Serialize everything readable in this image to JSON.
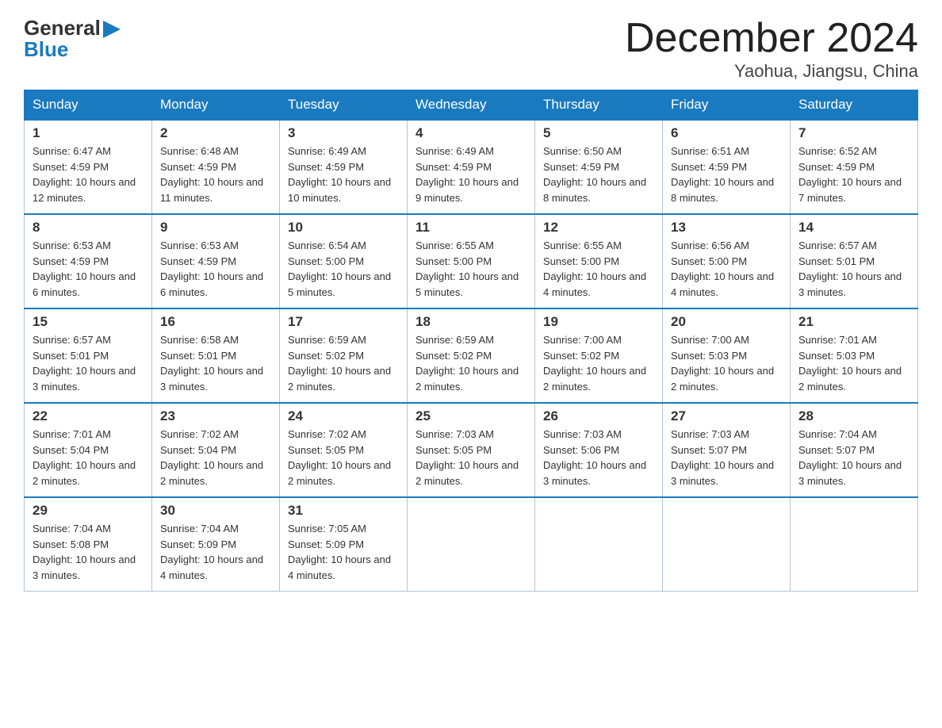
{
  "logo": {
    "line1": "General",
    "line2": "Blue",
    "triangle_color": "#1a7abf"
  },
  "header": {
    "month_title": "December 2024",
    "location": "Yaohua, Jiangsu, China"
  },
  "days_of_week": [
    "Sunday",
    "Monday",
    "Tuesday",
    "Wednesday",
    "Thursday",
    "Friday",
    "Saturday"
  ],
  "weeks": [
    [
      {
        "day": "1",
        "sunrise": "6:47 AM",
        "sunset": "4:59 PM",
        "daylight": "10 hours and 12 minutes."
      },
      {
        "day": "2",
        "sunrise": "6:48 AM",
        "sunset": "4:59 PM",
        "daylight": "10 hours and 11 minutes."
      },
      {
        "day": "3",
        "sunrise": "6:49 AM",
        "sunset": "4:59 PM",
        "daylight": "10 hours and 10 minutes."
      },
      {
        "day": "4",
        "sunrise": "6:49 AM",
        "sunset": "4:59 PM",
        "daylight": "10 hours and 9 minutes."
      },
      {
        "day": "5",
        "sunrise": "6:50 AM",
        "sunset": "4:59 PM",
        "daylight": "10 hours and 8 minutes."
      },
      {
        "day": "6",
        "sunrise": "6:51 AM",
        "sunset": "4:59 PM",
        "daylight": "10 hours and 8 minutes."
      },
      {
        "day": "7",
        "sunrise": "6:52 AM",
        "sunset": "4:59 PM",
        "daylight": "10 hours and 7 minutes."
      }
    ],
    [
      {
        "day": "8",
        "sunrise": "6:53 AM",
        "sunset": "4:59 PM",
        "daylight": "10 hours and 6 minutes."
      },
      {
        "day": "9",
        "sunrise": "6:53 AM",
        "sunset": "4:59 PM",
        "daylight": "10 hours and 6 minutes."
      },
      {
        "day": "10",
        "sunrise": "6:54 AM",
        "sunset": "5:00 PM",
        "daylight": "10 hours and 5 minutes."
      },
      {
        "day": "11",
        "sunrise": "6:55 AM",
        "sunset": "5:00 PM",
        "daylight": "10 hours and 5 minutes."
      },
      {
        "day": "12",
        "sunrise": "6:55 AM",
        "sunset": "5:00 PM",
        "daylight": "10 hours and 4 minutes."
      },
      {
        "day": "13",
        "sunrise": "6:56 AM",
        "sunset": "5:00 PM",
        "daylight": "10 hours and 4 minutes."
      },
      {
        "day": "14",
        "sunrise": "6:57 AM",
        "sunset": "5:01 PM",
        "daylight": "10 hours and 3 minutes."
      }
    ],
    [
      {
        "day": "15",
        "sunrise": "6:57 AM",
        "sunset": "5:01 PM",
        "daylight": "10 hours and 3 minutes."
      },
      {
        "day": "16",
        "sunrise": "6:58 AM",
        "sunset": "5:01 PM",
        "daylight": "10 hours and 3 minutes."
      },
      {
        "day": "17",
        "sunrise": "6:59 AM",
        "sunset": "5:02 PM",
        "daylight": "10 hours and 2 minutes."
      },
      {
        "day": "18",
        "sunrise": "6:59 AM",
        "sunset": "5:02 PM",
        "daylight": "10 hours and 2 minutes."
      },
      {
        "day": "19",
        "sunrise": "7:00 AM",
        "sunset": "5:02 PM",
        "daylight": "10 hours and 2 minutes."
      },
      {
        "day": "20",
        "sunrise": "7:00 AM",
        "sunset": "5:03 PM",
        "daylight": "10 hours and 2 minutes."
      },
      {
        "day": "21",
        "sunrise": "7:01 AM",
        "sunset": "5:03 PM",
        "daylight": "10 hours and 2 minutes."
      }
    ],
    [
      {
        "day": "22",
        "sunrise": "7:01 AM",
        "sunset": "5:04 PM",
        "daylight": "10 hours and 2 minutes."
      },
      {
        "day": "23",
        "sunrise": "7:02 AM",
        "sunset": "5:04 PM",
        "daylight": "10 hours and 2 minutes."
      },
      {
        "day": "24",
        "sunrise": "7:02 AM",
        "sunset": "5:05 PM",
        "daylight": "10 hours and 2 minutes."
      },
      {
        "day": "25",
        "sunrise": "7:03 AM",
        "sunset": "5:05 PM",
        "daylight": "10 hours and 2 minutes."
      },
      {
        "day": "26",
        "sunrise": "7:03 AM",
        "sunset": "5:06 PM",
        "daylight": "10 hours and 3 minutes."
      },
      {
        "day": "27",
        "sunrise": "7:03 AM",
        "sunset": "5:07 PM",
        "daylight": "10 hours and 3 minutes."
      },
      {
        "day": "28",
        "sunrise": "7:04 AM",
        "sunset": "5:07 PM",
        "daylight": "10 hours and 3 minutes."
      }
    ],
    [
      {
        "day": "29",
        "sunrise": "7:04 AM",
        "sunset": "5:08 PM",
        "daylight": "10 hours and 3 minutes."
      },
      {
        "day": "30",
        "sunrise": "7:04 AM",
        "sunset": "5:09 PM",
        "daylight": "10 hours and 4 minutes."
      },
      {
        "day": "31",
        "sunrise": "7:05 AM",
        "sunset": "5:09 PM",
        "daylight": "10 hours and 4 minutes."
      },
      null,
      null,
      null,
      null
    ]
  ]
}
